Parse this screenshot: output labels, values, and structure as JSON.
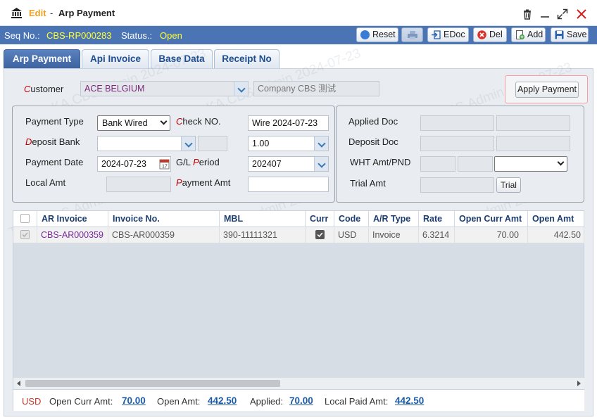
{
  "title": {
    "edit": "Edit",
    "sep": "-",
    "name": "Arp Payment"
  },
  "status_bar": {
    "seq_label": "Seq No.:",
    "seq_value": "CBS-RP000283",
    "status_label": "Status.:",
    "status_value": "Open",
    "buttons": {
      "reset": "Reset",
      "edoc": "EDoc",
      "del": "Del",
      "add": "Add",
      "save": "Save"
    }
  },
  "tabs": [
    "Arp Payment",
    "Api Invoice",
    "Base Data",
    "Receipt No"
  ],
  "customer": {
    "label_first": "C",
    "label_rest": "ustomer",
    "value": "ACE BELGIUM",
    "company": "Company CBS 测试",
    "apply_button": "Apply Payment"
  },
  "left_form": {
    "payment_type_label": "Payment Type",
    "payment_type_value": "Bank Wired",
    "check_no_label_first": "C",
    "check_no_label_rest": "heck NO.",
    "check_no_value": "Wire 2024-07-23",
    "deposit_bank_label_first": "D",
    "deposit_bank_label_rest": "eposit Bank",
    "deposit_bank_value": "",
    "rate_value": "1.00",
    "payment_date_label": "Payment Date",
    "payment_date_value": "2024-07-23",
    "gl_period_label_pre": "G/L ",
    "gl_period_label_first": "P",
    "gl_period_label_rest": "eriod",
    "gl_period_value": "202407",
    "local_amt_label": "Local Amt",
    "local_amt_value": "",
    "payment_amt_label_first": "P",
    "payment_amt_label_rest": "ayment Amt",
    "payment_amt_value": ""
  },
  "right_form": {
    "applied_doc_label": "Applied Doc",
    "deposit_doc_label": "Deposit Doc",
    "wht_label": "WHT Amt/PND",
    "trial_amt_label": "Trial Amt",
    "trial_button": "Trial"
  },
  "grid": {
    "headers": [
      "AR Invoice",
      "Invoice No.",
      "MBL",
      "Curr",
      "Code",
      "A/R Type",
      "Rate",
      "Open Curr Amt",
      "Open Amt"
    ],
    "rows": [
      {
        "ar_invoice": "CBS-AR000359",
        "invoice_no": "CBS-AR000359",
        "mbl": "390-11111321",
        "code": "USD",
        "ar_type": "Invoice",
        "rate": "6.3214",
        "open_curr_amt": "70.00",
        "open_amt": "442.50"
      }
    ]
  },
  "footer": {
    "currency": "USD",
    "open_curr_label": "Open Curr Amt:",
    "open_curr_value": "70.00",
    "open_amt_label": "Open Amt:",
    "open_amt_value": "442.50",
    "applied_label": "Applied:",
    "applied_value": "70.00",
    "local_paid_label": "Local Paid Amt:",
    "local_paid_value": "442.50"
  },
  "watermark": "TLKA.CBS.Admin 2024-07-23",
  "colors": {
    "accent": "#4a74b4",
    "status_yellow": "#ffff33",
    "edit_orange": "#f0a020",
    "required_red": "#c00000",
    "link_blue": "#1d5aa6"
  }
}
